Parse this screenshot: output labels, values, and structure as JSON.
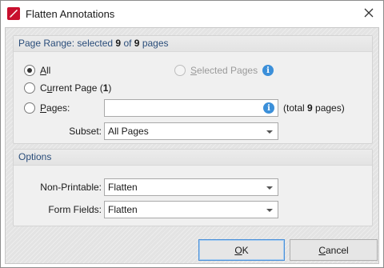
{
  "window": {
    "title": "Flatten Annotations"
  },
  "page_range": {
    "header_prefix": "Page Range: selected ",
    "selected_count": "9",
    "header_mid": " of ",
    "total_count": "9",
    "header_suffix": " pages",
    "options": {
      "all": {
        "label_u": "A",
        "label_rest": "ll",
        "checked": true
      },
      "current_page": {
        "label_pre": "C",
        "label_u": "u",
        "label_rest": "rrent Page (",
        "count": "1",
        "label_close": ")"
      },
      "pages": {
        "label_u": "P",
        "label_rest": "ages:",
        "value": ""
      },
      "selected_pages": {
        "label_u": "S",
        "label_rest": "elected Pages",
        "enabled": false
      }
    },
    "total_pages_note_prefix": "(total ",
    "total_pages_count": "9",
    "total_pages_note_suffix": " pages)",
    "subset_label": "Subset:",
    "subset_value": "All Pages"
  },
  "options_group": {
    "header": "Options",
    "non_printable_label": "Non-Printable:",
    "non_printable_value": "Flatten",
    "form_fields_label": "Form Fields:",
    "form_fields_value": "Flatten"
  },
  "buttons": {
    "ok_u": "O",
    "ok_rest": "K",
    "cancel_u": "C",
    "cancel_rest": "ancel"
  },
  "colors": {
    "accent_blue": "#3b8fd9",
    "brand_red": "#c8102e",
    "header_text": "#2a4d7a"
  },
  "icons": {
    "app": "pdf-red-logo-icon",
    "close": "close-icon",
    "info": "info-icon",
    "dropdown": "chevron-down-icon"
  }
}
